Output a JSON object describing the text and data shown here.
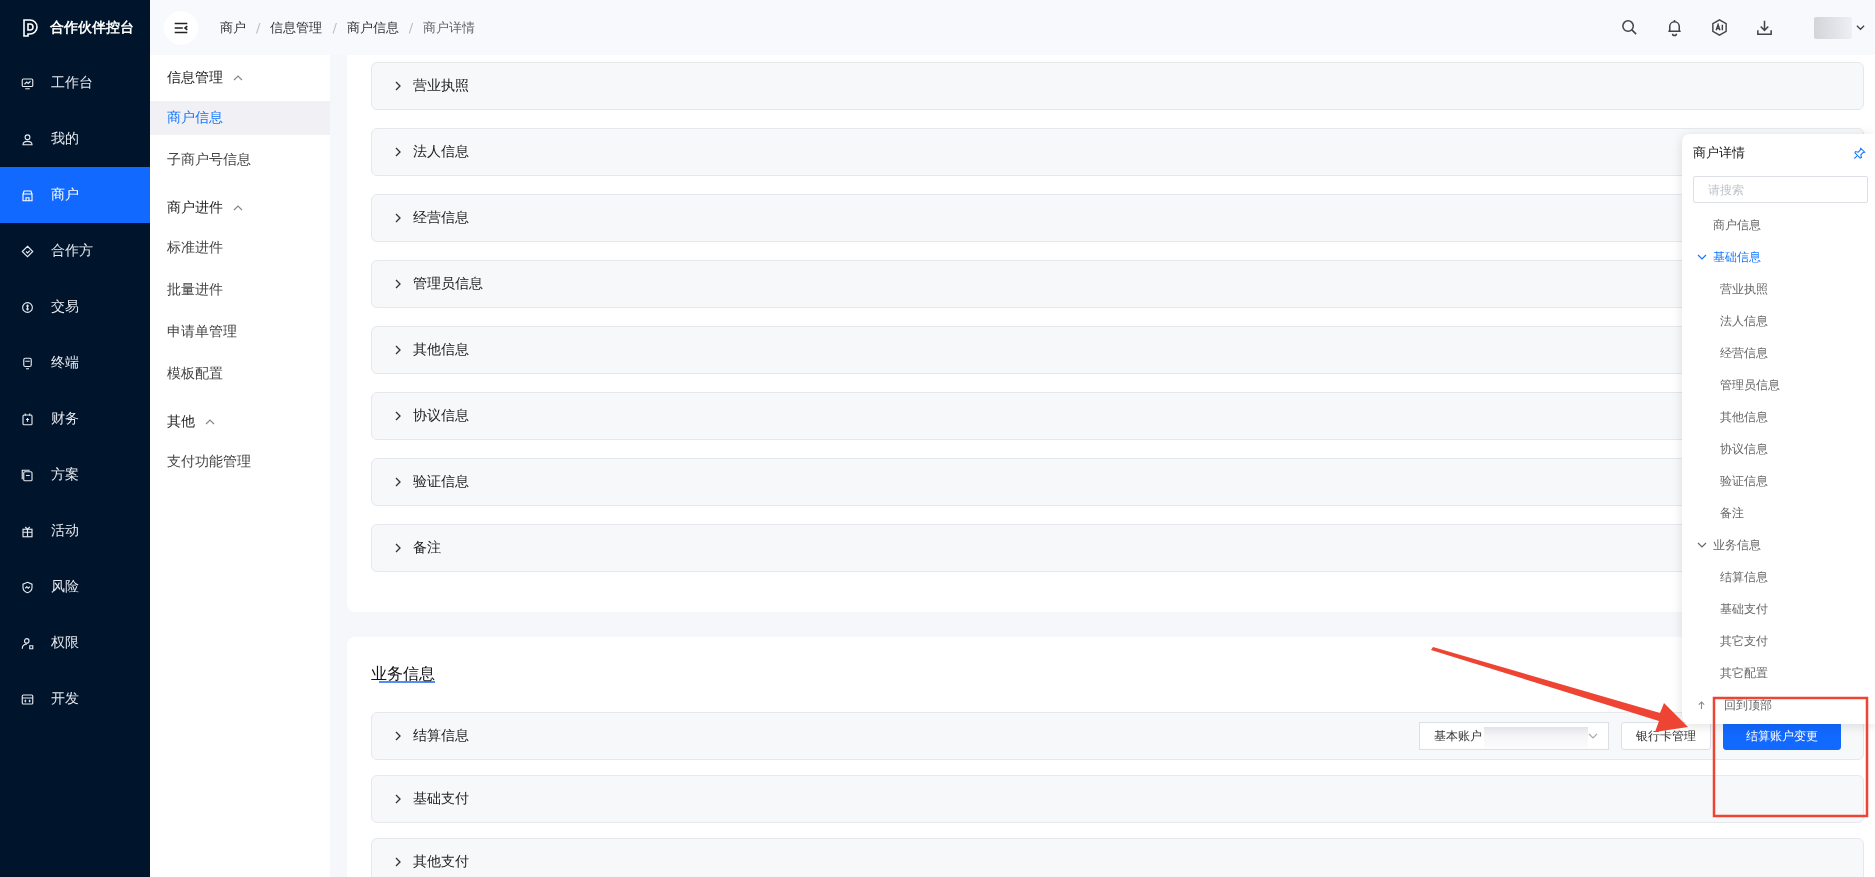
{
  "brand": {
    "title": "合作伙伴控台"
  },
  "nav": [
    {
      "label": "工作台",
      "kind": "monitor",
      "selected": false
    },
    {
      "label": "我的",
      "kind": "user",
      "selected": false
    },
    {
      "label": "商户",
      "kind": "store",
      "selected": true
    },
    {
      "label": "合作方",
      "kind": "tag",
      "selected": false
    },
    {
      "label": "交易",
      "kind": "coin",
      "selected": false
    },
    {
      "label": "终端",
      "kind": "terminal",
      "selected": false
    },
    {
      "label": "财务",
      "kind": "ledger",
      "selected": false
    },
    {
      "label": "方案",
      "kind": "document",
      "selected": false
    },
    {
      "label": "活动",
      "kind": "gift",
      "selected": false
    },
    {
      "label": "风险",
      "kind": "shield",
      "selected": false
    },
    {
      "label": "权限",
      "kind": "person",
      "selected": false
    },
    {
      "label": "开发",
      "kind": "code",
      "selected": false
    }
  ],
  "breadcrumb": {
    "separator": "/",
    "items": [
      "商户",
      "信息管理",
      "商户信息",
      "商户详情"
    ]
  },
  "submenu": [
    {
      "label": "信息管理",
      "expanded": true,
      "children": [
        {
          "label": "商户信息",
          "selected": true
        },
        {
          "label": "子商户号信息",
          "selected": false
        }
      ]
    },
    {
      "label": "商户进件",
      "expanded": true,
      "children": [
        {
          "label": "标准进件",
          "selected": false
        },
        {
          "label": "批量进件",
          "selected": false
        },
        {
          "label": "申请单管理",
          "selected": false
        },
        {
          "label": "模板配置",
          "selected": false
        }
      ]
    },
    {
      "label": "其他",
      "expanded": true,
      "children": [
        {
          "label": "支付功能管理",
          "selected": false
        }
      ]
    }
  ],
  "sections": [
    {
      "title": "营业执照",
      "expanded": false
    },
    {
      "title": "法人信息",
      "expanded": false
    },
    {
      "title": "经营信息",
      "expanded": false
    },
    {
      "title": "管理员信息",
      "expanded": false
    },
    {
      "title": "其他信息",
      "expanded": false
    },
    {
      "title": "协议信息",
      "expanded": false
    },
    {
      "title": "验证信息",
      "expanded": false
    },
    {
      "title": "备注",
      "expanded": false
    }
  ],
  "business": {
    "title": "业务信息",
    "sections": [
      {
        "title": "结算信息",
        "expanded": false,
        "select": {
          "value": "基本账户"
        },
        "buttons": [
          {
            "label": "银行卡管理",
            "kind": "default"
          },
          {
            "label": "结算账户变更",
            "kind": "primary"
          }
        ]
      },
      {
        "title": "基础支付",
        "expanded": false
      },
      {
        "title": "其他支付",
        "expanded": false
      }
    ]
  },
  "outline": {
    "title": "商户详情",
    "search": {
      "placeholder": "请搜索"
    },
    "items": [
      {
        "label": "商户信息",
        "selected": false
      },
      {
        "label": "基础信息",
        "selected": true,
        "expanded": true,
        "children": [
          {
            "label": "营业执照",
            "selected": false
          },
          {
            "label": "法人信息",
            "selected": false
          },
          {
            "label": "经营信息",
            "selected": false
          },
          {
            "label": "管理员信息",
            "selected": false
          },
          {
            "label": "其他信息",
            "selected": false
          },
          {
            "label": "协议信息",
            "selected": false
          },
          {
            "label": "验证信息",
            "selected": false
          },
          {
            "label": "备注",
            "selected": false
          }
        ]
      },
      {
        "label": "业务信息",
        "selected": false,
        "expanded": true,
        "children": [
          {
            "label": "结算信息",
            "selected": false
          },
          {
            "label": "基础支付",
            "selected": false
          },
          {
            "label": "其它支付",
            "selected": false
          },
          {
            "label": "其它配置",
            "selected": false
          }
        ]
      }
    ],
    "back_to_top": "回到顶部"
  },
  "annotations": [
    {
      "kind": "arrow",
      "color": "#ee4433"
    },
    {
      "kind": "box",
      "color": "#ee4433"
    }
  ]
}
